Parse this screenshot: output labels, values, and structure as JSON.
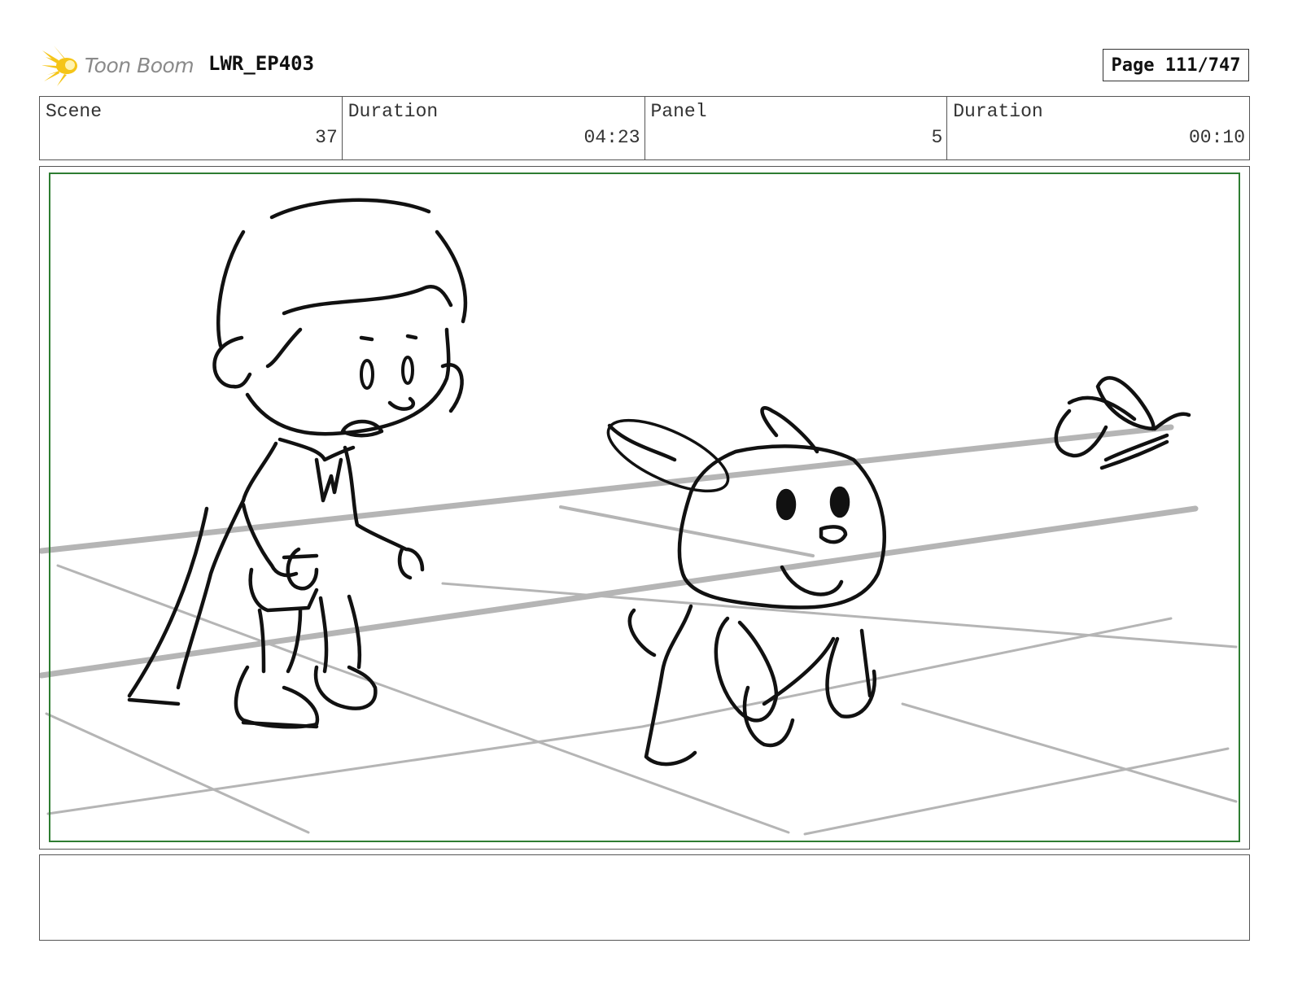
{
  "header": {
    "logo_text": "Toon Boom",
    "project": "LWR_EP403",
    "page": "Page 111/747"
  },
  "info": {
    "scene_label": "Scene",
    "scene_value": "37",
    "scene_duration_label": "Duration",
    "scene_duration_value": "04:23",
    "panel_label": "Panel",
    "panel_value": "5",
    "panel_duration_label": "Duration",
    "panel_duration_value": "00:10"
  },
  "colors": {
    "logo_yellow": "#f5c518",
    "safe_area_green": "#2e7d32",
    "sketch_ink": "#111111",
    "floor_grey": "#b0b0b0"
  },
  "panel": {
    "content": "storyboard sketch: boy in cape looking at small dog with butterfly"
  },
  "notes": ""
}
